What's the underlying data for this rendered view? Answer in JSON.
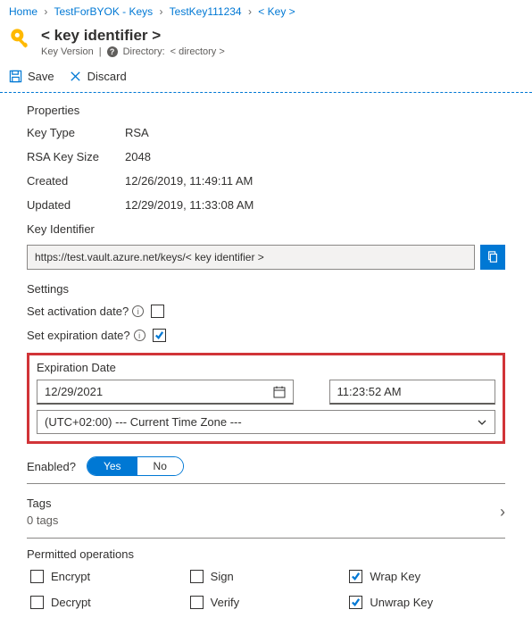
{
  "breadcrumb": {
    "items": [
      "Home",
      "TestForBYOK - Keys",
      "TestKey111234",
      "< Key >"
    ]
  },
  "header": {
    "title": "< key identifier >",
    "subtitle": "Key Version",
    "directory_label": "Directory:",
    "directory_value": "< directory >"
  },
  "toolbar": {
    "save": "Save",
    "discard": "Discard"
  },
  "properties": {
    "section": "Properties",
    "key_type_label": "Key Type",
    "key_type_value": "RSA",
    "rsa_size_label": "RSA Key Size",
    "rsa_size_value": "2048",
    "created_label": "Created",
    "created_value": "12/26/2019, 11:49:11 AM",
    "updated_label": "Updated",
    "updated_value": "12/29/2019, 11:33:08 AM",
    "key_identifier_label": "Key Identifier",
    "key_identifier_value": "https://test.vault.azure.net/keys/< key identifier >"
  },
  "settings": {
    "section": "Settings",
    "activation_label": "Set activation date?",
    "expiration_label": "Set expiration date?",
    "expiration_date_label": "Expiration Date",
    "expiration_date": "12/29/2021",
    "expiration_time": "11:23:52 AM",
    "timezone": "(UTC+02:00) --- Current Time Zone ---",
    "enabled_label": "Enabled?",
    "enabled_yes": "Yes",
    "enabled_no": "No"
  },
  "tags": {
    "label": "Tags",
    "count": "0 tags"
  },
  "operations": {
    "section": "Permitted operations",
    "encrypt": "Encrypt",
    "decrypt": "Decrypt",
    "sign": "Sign",
    "verify": "Verify",
    "wrap": "Wrap Key",
    "unwrap": "Unwrap Key"
  }
}
